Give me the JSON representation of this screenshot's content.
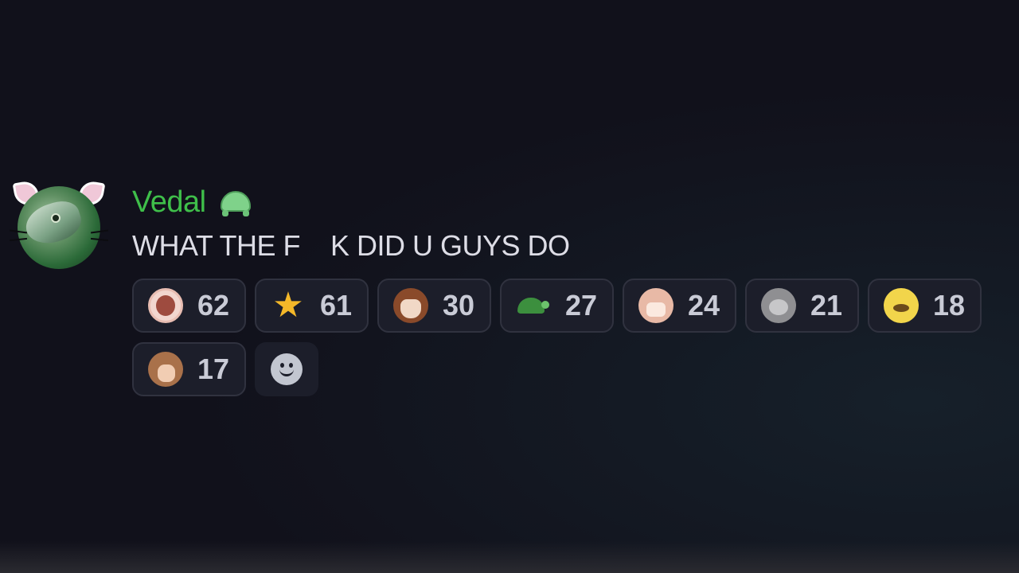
{
  "message": {
    "username": "Vedal",
    "username_color": "#3fbf4a",
    "role_icon": "turtle-icon",
    "text": "WHAT THE F    K DID U GUYS DO"
  },
  "reactions": [
    {
      "emoji": "screaming-mouth-emoji",
      "count": "62"
    },
    {
      "emoji": "star-emoji",
      "count": "61"
    },
    {
      "emoji": "grinning-girl-emoji",
      "count": "30"
    },
    {
      "emoji": "turtle-emoji",
      "count": "27"
    },
    {
      "emoji": "crying-girl-emoji",
      "count": "24"
    },
    {
      "emoji": "cat-emoji",
      "count": "21"
    },
    {
      "emoji": "yellow-face-emoji",
      "count": "18"
    },
    {
      "emoji": "laughing-face-emoji",
      "count": "17"
    }
  ],
  "add_reaction": {
    "icon": "smile-icon"
  },
  "colors": {
    "background": "#11111b",
    "reaction_bg": "#1c1e2a",
    "reaction_border": "#30323f",
    "text": "#dddde6"
  }
}
